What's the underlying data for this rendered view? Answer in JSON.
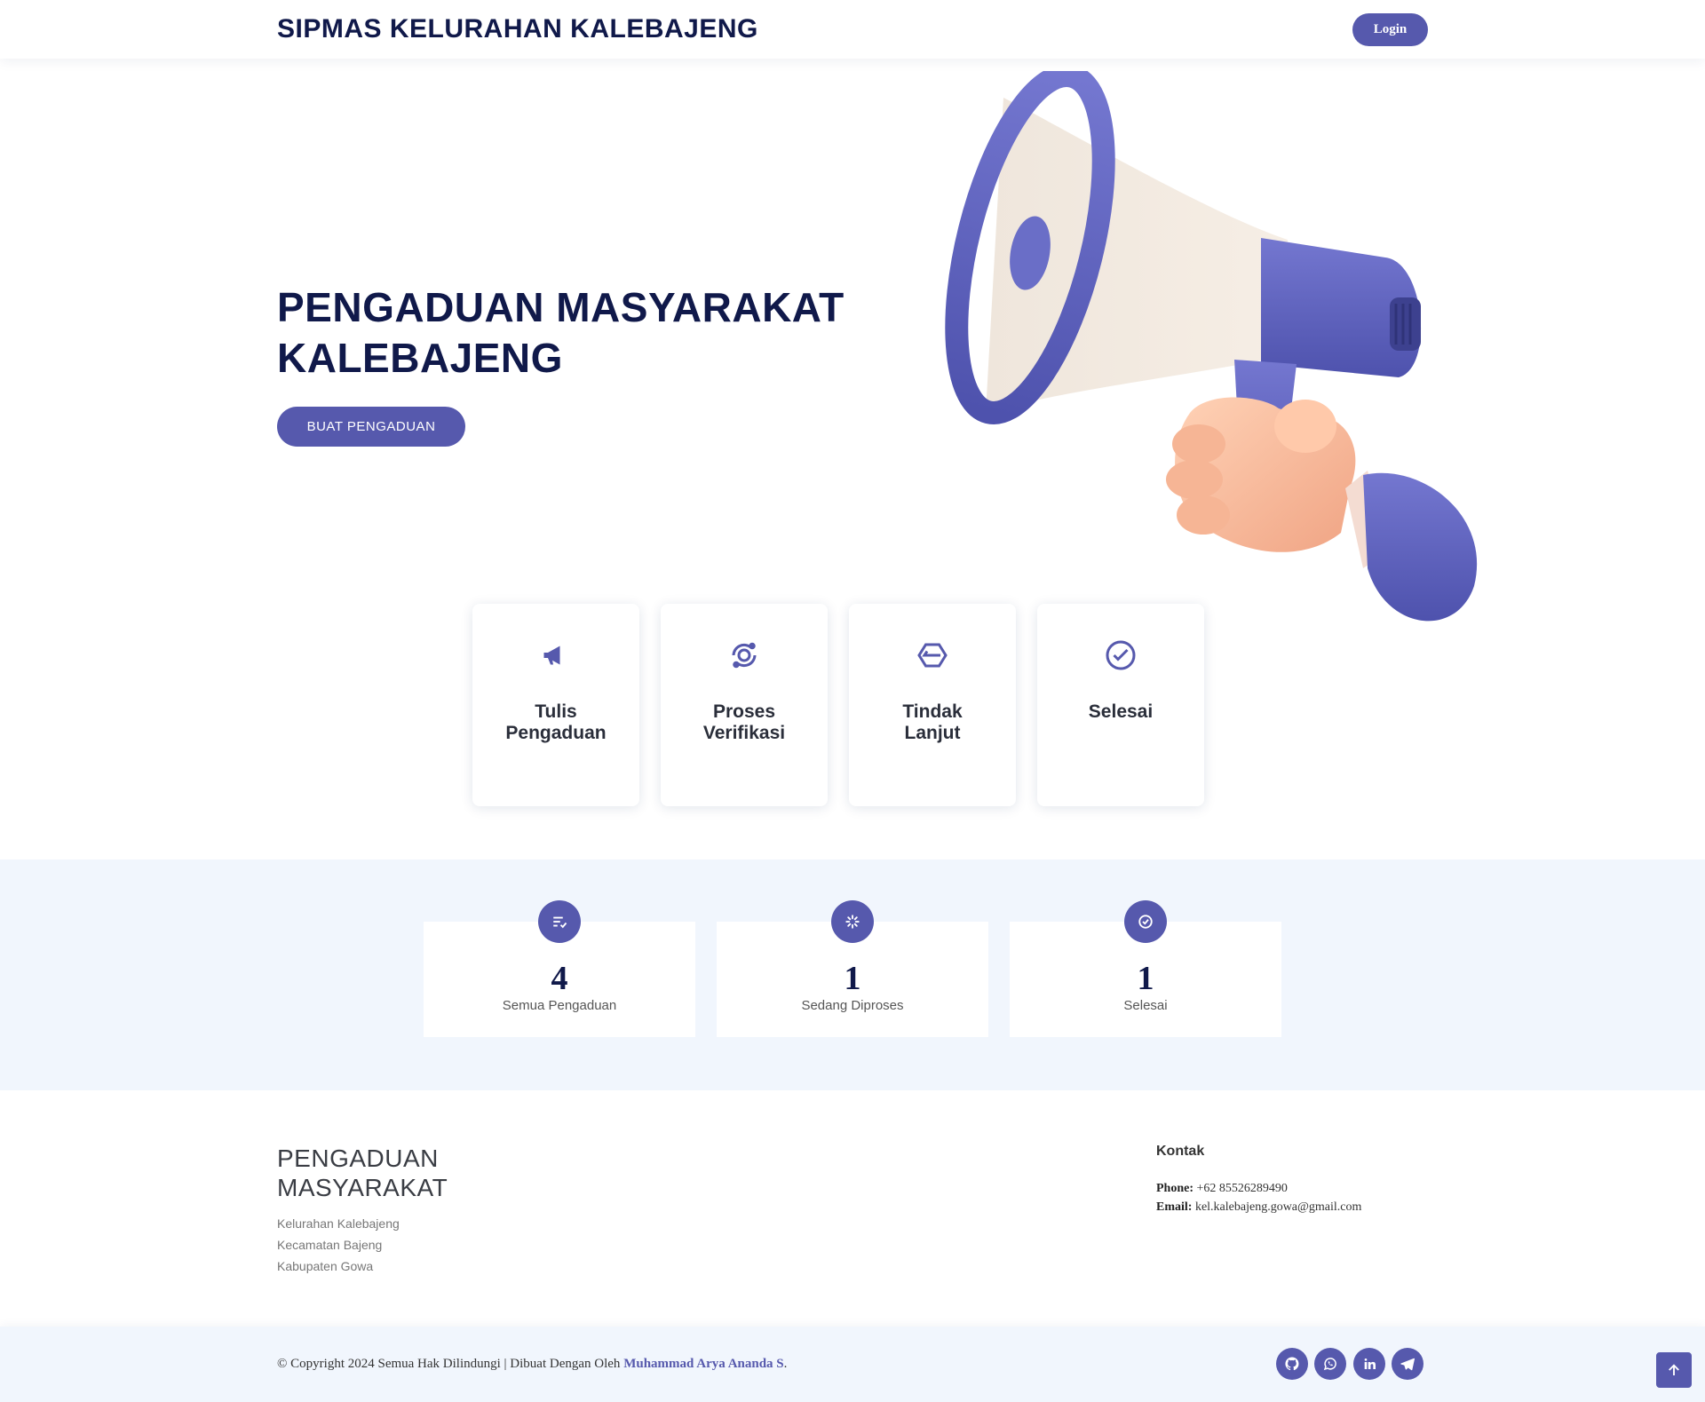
{
  "header": {
    "brand": "SIPMAS KELURAHAN KALEBAJENG",
    "login_label": "Login"
  },
  "hero": {
    "title_line1": "PENGADUAN MASYARAKAT",
    "title_line2": "KALEBAJENG",
    "cta_label": "BUAT PENGADUAN",
    "illustration": "megaphone-illustration"
  },
  "steps": [
    {
      "icon": "megaphone-icon",
      "line1": "Tulis",
      "line2": "Pengaduan"
    },
    {
      "icon": "verify-icon",
      "line1": "Proses",
      "line2": "Verifikasi"
    },
    {
      "icon": "hexagon-icon",
      "line1": "Tindak",
      "line2": "Lanjut"
    },
    {
      "icon": "check-circle-icon",
      "line1": "Selesai",
      "line2": ""
    }
  ],
  "stats": [
    {
      "icon": "list-check-icon",
      "value": "4",
      "caption": "Semua Pengaduan"
    },
    {
      "icon": "loader-icon",
      "value": "1",
      "caption": "Sedang Diproses"
    },
    {
      "icon": "check-circle-icon",
      "value": "1",
      "caption": "Selesai"
    }
  ],
  "footer": {
    "title_line1": "PENGADUAN",
    "title_line2": "MASYARAKAT",
    "address": [
      "Kelurahan Kalebajeng",
      "Kecamatan Bajeng",
      "Kabupaten Gowa"
    ],
    "contact_heading": "Kontak",
    "phone_label": "Phone:",
    "phone": "+62 85526289490",
    "email_label": "Email:",
    "email": "kel.kalebajeng.gowa@gmail.com",
    "copyright": "© Copyright 2024 Semua Hak Dilindungi | Dibuat Dengan Oleh",
    "author": "Muhammad Arya Ananda S",
    "author_suffix": ".",
    "social": [
      "github-icon",
      "whatsapp-icon",
      "linkedin-icon",
      "telegram-icon"
    ]
  },
  "colors": {
    "primary": "#5659ad",
    "heading": "#10194a",
    "band": "#f1f6fd"
  }
}
